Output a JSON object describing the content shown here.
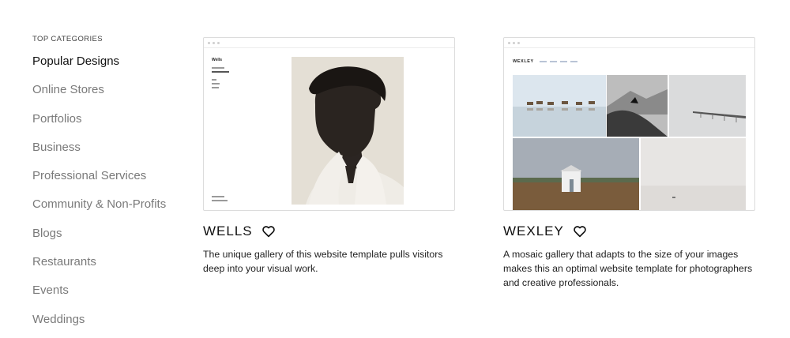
{
  "sidebar": {
    "heading": "TOP CATEGORIES",
    "items": [
      {
        "label": "Popular Designs",
        "active": true
      },
      {
        "label": "Online Stores"
      },
      {
        "label": "Portfolios"
      },
      {
        "label": "Business"
      },
      {
        "label": "Professional Services"
      },
      {
        "label": "Community & Non-Profits"
      },
      {
        "label": "Blogs"
      },
      {
        "label": "Restaurants"
      },
      {
        "label": "Events"
      },
      {
        "label": "Weddings"
      }
    ]
  },
  "templates": [
    {
      "name": "WELLS",
      "description": "The unique gallery of this website template pulls visitors deep into your visual work.",
      "preview_logo": "Wells"
    },
    {
      "name": "WEXLEY",
      "description": "A mosaic gallery that adapts to the size of your images makes this an optimal website template for photographers and creative professionals.",
      "preview_logo": "WEXLEY"
    }
  ],
  "colors": {
    "active_text": "#111111",
    "muted_text": "#7a7a7a",
    "border": "#dcdcdc"
  }
}
